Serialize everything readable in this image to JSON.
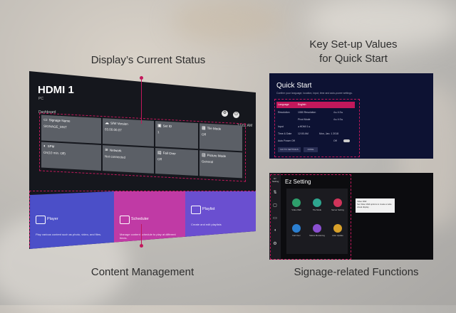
{
  "captions": {
    "current_status": "Display’s Current Status",
    "key_values_line1": "Key Set-up Values",
    "key_values_line2": "for Quick Start",
    "content_management": "Content Management",
    "signage_functions": "Signage-related Functions"
  },
  "tv": {
    "input": "HDMI 1",
    "input_sub": "PC",
    "section": "Dashboard",
    "time": "12:02 AM",
    "tiles": [
      {
        "icon": "display-icon",
        "label": "Signage Name",
        "value": "SIGNAGE_MNT"
      },
      {
        "icon": "software-icon",
        "label": "S/W Version",
        "value": "03.00.00.07"
      },
      {
        "icon": "sd-icon",
        "label": "Set ID",
        "value": "1"
      },
      {
        "icon": "tile-mode-icon",
        "label": "Tile Mode",
        "value": "Off"
      },
      {
        "icon": "spm-icon",
        "label": "SPM",
        "value": "On(10 min. Off)"
      },
      {
        "icon": "network-icon",
        "label": "Network",
        "value": "Not connected"
      },
      {
        "icon": "fail-over-icon",
        "label": "Fail Over",
        "value": "Off"
      },
      {
        "icon": "picture-mode-icon",
        "label": "Picture Mode",
        "value": "General"
      }
    ],
    "cards": [
      {
        "title": "Player",
        "desc": "Play various content such as photo, video, and files."
      },
      {
        "title": "Scheduler",
        "desc": "Manage content schedule to play at different times."
      },
      {
        "title": "Playlist",
        "desc": "Create and edit playlists"
      }
    ]
  },
  "quick_start": {
    "title": "Quick Start",
    "subtitle": "Confirm your language, location, input, time and auto-power settings.",
    "rows": [
      {
        "label": "Language",
        "value": "English",
        "extra": ""
      },
      {
        "label": "Resolution",
        "value": "1080 Resolution",
        "extra": "4  ▸  4:3  ▸"
      },
      {
        "label": "",
        "value": "Pivot Mode",
        "extra": "4  ▸  4:3  ▸"
      },
      {
        "label": "Input",
        "value": "◂  HDMI 1  ▸",
        "extra": ""
      },
      {
        "label": "Time & Date",
        "value": "12:00 AM",
        "extra": "Mon, Jan. 1 2018"
      },
      {
        "label": "Auto Power Off",
        "value": "",
        "extra": "Off"
      }
    ],
    "buttons": [
      "GO TO SETTINGS",
      "DONE"
    ]
  },
  "ez_setting": {
    "title": "Ez Setting",
    "sidebar": [
      "Ez Setting",
      "Network",
      "General",
      "Display",
      "Sound",
      "Admin"
    ],
    "items": [
      {
        "label": "Video Wall",
        "color": "#2e9e6b"
      },
      {
        "label": "Tile Mode",
        "color": "#2ea68f"
      },
      {
        "label": "Server Setting",
        "color": "#d0345a"
      },
      {
        "label": "Fail Over",
        "color": "#2b7fd1"
      },
      {
        "label": "Status Monitoring",
        "color": "#8a4fd0"
      },
      {
        "label": "Auto Update",
        "color": "#d9a12a"
      }
    ],
    "tip_title": "Video Wall",
    "tip_text": "Set Video Wall options to create a wide visual display."
  }
}
